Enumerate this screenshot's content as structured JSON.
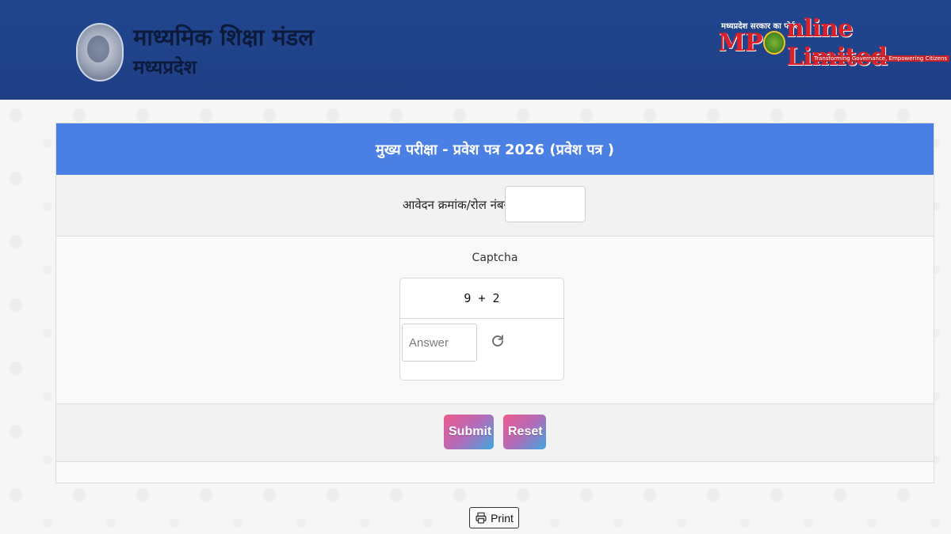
{
  "header": {
    "org_title": "माध्यमिक शिक्षा मंडल",
    "org_subtitle": "मध्यप्रदेश",
    "partner_small": "मध्यप्रदेश सरकार का पोर्टल",
    "partner_logo_left": "MP",
    "partner_logo_right": "nline Limited",
    "partner_tagline": "Transforming Governance, Empowering Citizens"
  },
  "form": {
    "title": "मुख्य परीक्षा - प्रवेश पत्र 2026 (प्रवेश पत्र )",
    "roll_label": "आवेदन क्रमांक/रोल नंबर",
    "required_mark": "*",
    "roll_value": "",
    "captcha_label": "Captcha",
    "captcha_question": "9 + 2",
    "captcha_answer_placeholder": "Answer",
    "submit_label": "Submit",
    "reset_label": "Reset"
  },
  "footer": {
    "print_label": "Print"
  },
  "colors": {
    "header_bg": "#21468f",
    "title_bar": "#4a80e3",
    "required": "#d8212b"
  },
  "icons": {
    "emblem": "mp-board-emblem",
    "refresh": "refresh-icon",
    "print": "printer-icon"
  }
}
